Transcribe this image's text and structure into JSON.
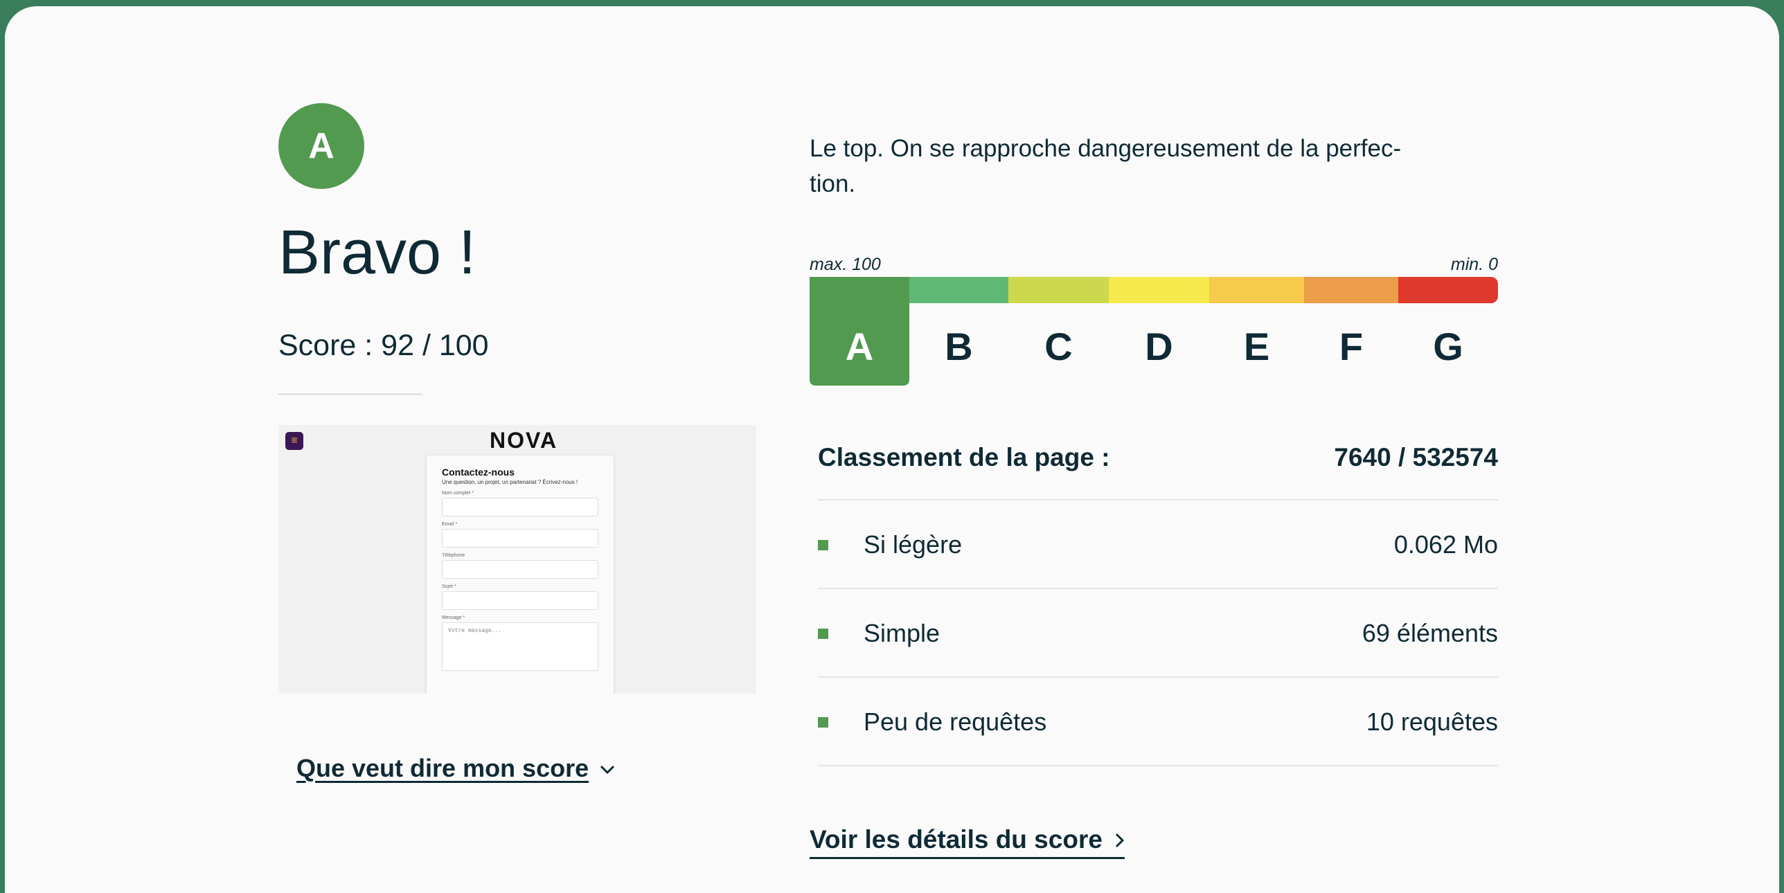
{
  "result": {
    "grade": "A",
    "heading": "Bravo !",
    "score_text": "Score : 92 / 100",
    "meaning_link": "Que veut dire mon score",
    "grade_color": "#529a4f"
  },
  "thumbnail": {
    "logo": "NOVA",
    "form_title": "Contactez-nous",
    "form_subtitle": "Une question, un projet, un partenariat ? Écrivez-nous !",
    "fields": [
      "Nom complet *",
      "Email *",
      "Téléphone",
      "Sujet *"
    ],
    "message_label": "Message *",
    "message_placeholder": "Votre message..."
  },
  "scale": {
    "tagline": "Le top. On se rapproche dangereusement de la perfec-tion.",
    "max_label": "max. 100",
    "min_label": "min. 0",
    "grades": [
      "A",
      "B",
      "C",
      "D",
      "E",
      "F",
      "G"
    ],
    "active_grade": "A",
    "colors": [
      "#529a4f",
      "#5fb876",
      "#cdd94c",
      "#f6e94e",
      "#f6cb4b",
      "#eb9d49",
      "#df3a2d"
    ]
  },
  "ranking": {
    "label": "Classement de la page :",
    "value": "7640 / 532574"
  },
  "metrics": [
    {
      "label": "Si légère",
      "value": "0.062 Mo"
    },
    {
      "label": "Simple",
      "value": "69 éléments"
    },
    {
      "label": "Peu de requêtes",
      "value": "10 requêtes"
    }
  ],
  "details_link": "Voir les détails du score"
}
